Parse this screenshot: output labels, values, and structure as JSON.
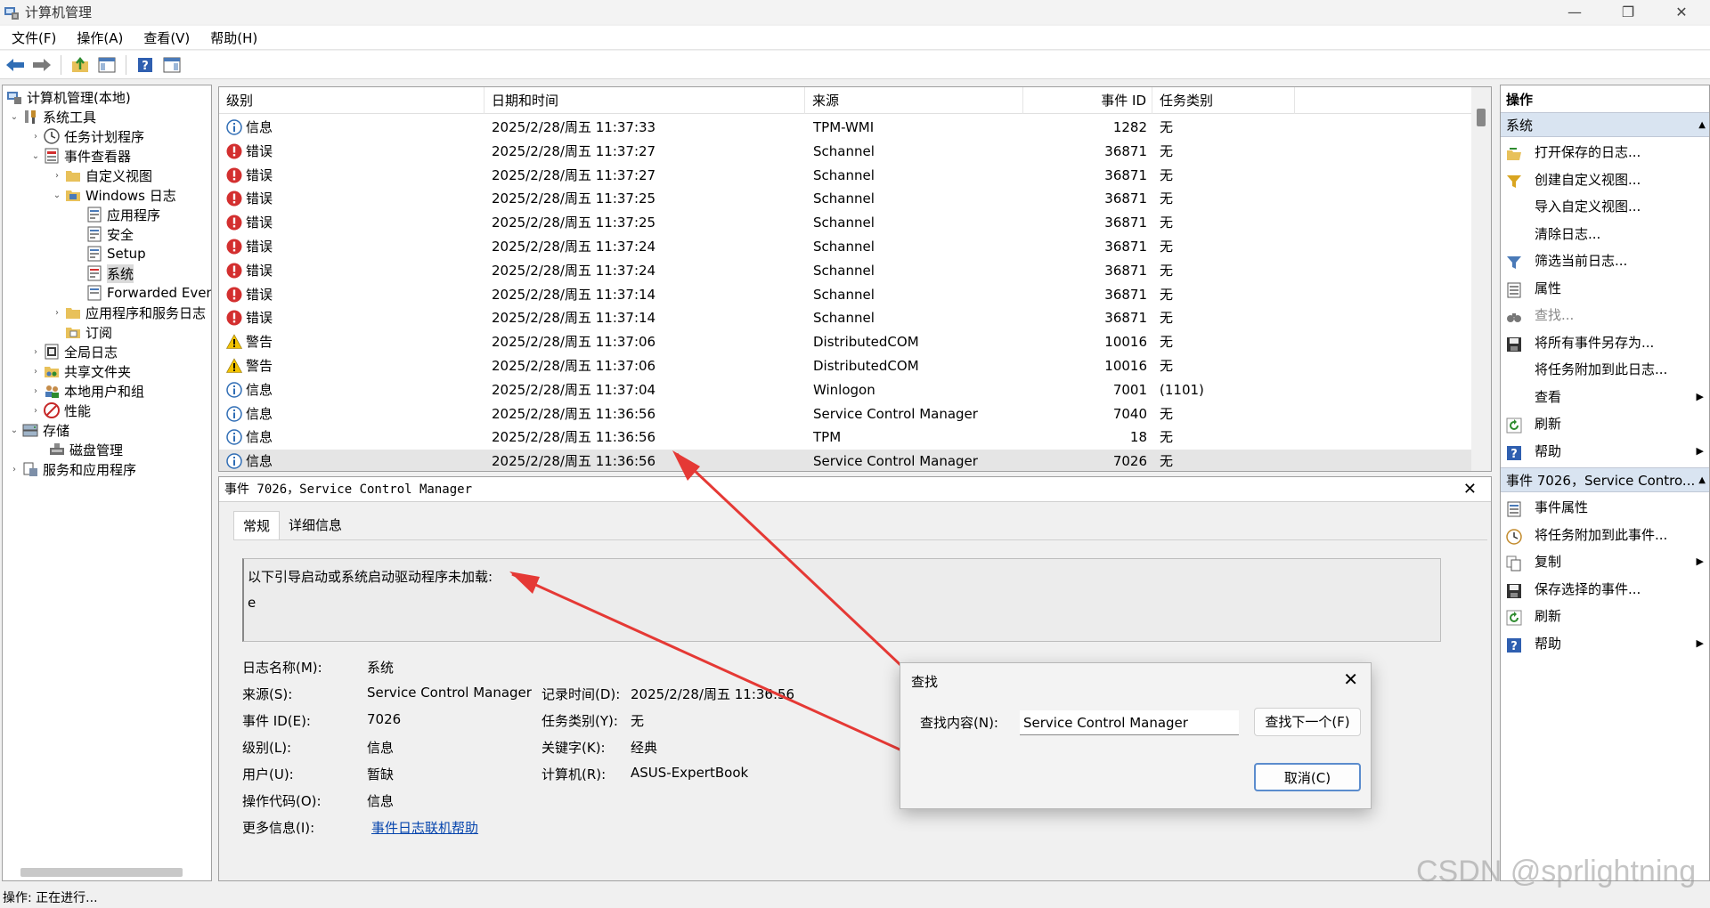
{
  "window": {
    "title": "计算机管理",
    "minimize": "—",
    "maximize": "❐",
    "close": "✕"
  },
  "menu": [
    "文件(F)",
    "操作(A)",
    "查看(V)",
    "帮助(H)"
  ],
  "tree": [
    {
      "label": "计算机管理(本地)",
      "icon": "computer-management-icon"
    },
    {
      "label": "系统工具",
      "icon": "tools-icon",
      "exp": "⌄"
    },
    {
      "label": "任务计划程序",
      "icon": "clock-icon",
      "exp": "›"
    },
    {
      "label": "事件查看器",
      "icon": "event-viewer-icon",
      "exp": "⌄"
    },
    {
      "label": "自定义视图",
      "icon": "folder-icon",
      "exp": "›"
    },
    {
      "label": "Windows 日志",
      "icon": "folder-icon",
      "exp": "⌄"
    },
    {
      "label": "应用程序",
      "icon": "log-icon"
    },
    {
      "label": "安全",
      "icon": "log-icon"
    },
    {
      "label": "Setup",
      "icon": "log-icon"
    },
    {
      "label": "系统",
      "icon": "log-icon"
    },
    {
      "label": "Forwarded Even",
      "icon": "log-icon"
    },
    {
      "label": "应用程序和服务日志",
      "icon": "folder-icon",
      "exp": "›"
    },
    {
      "label": "订阅",
      "icon": "subscription-icon"
    },
    {
      "label": "全局日志",
      "icon": "log-icon",
      "exp": "›"
    },
    {
      "label": "共享文件夹",
      "icon": "shared-folder-icon",
      "exp": "›"
    },
    {
      "label": "本地用户和组",
      "icon": "users-icon",
      "exp": "›"
    },
    {
      "label": "性能",
      "icon": "performance-icon",
      "exp": "›"
    },
    {
      "label": "存储",
      "icon": "storage-icon",
      "exp": "⌄"
    },
    {
      "label": "磁盘管理",
      "icon": "disk-icon"
    },
    {
      "label": "服务和应用程序",
      "icon": "services-icon",
      "exp": "›"
    }
  ],
  "list": {
    "headers": [
      "级别",
      "日期和时间",
      "来源",
      "事件 ID",
      "任务类别"
    ],
    "rows": [
      {
        "level": "信息",
        "type": "info",
        "datetime": "2025/2/28/周五 11:37:33",
        "source": "TPM-WMI",
        "id": "1282",
        "task": "无"
      },
      {
        "level": "错误",
        "type": "error",
        "datetime": "2025/2/28/周五 11:37:27",
        "source": "Schannel",
        "id": "36871",
        "task": "无"
      },
      {
        "level": "错误",
        "type": "error",
        "datetime": "2025/2/28/周五 11:37:27",
        "source": "Schannel",
        "id": "36871",
        "task": "无"
      },
      {
        "level": "错误",
        "type": "error",
        "datetime": "2025/2/28/周五 11:37:25",
        "source": "Schannel",
        "id": "36871",
        "task": "无"
      },
      {
        "level": "错误",
        "type": "error",
        "datetime": "2025/2/28/周五 11:37:25",
        "source": "Schannel",
        "id": "36871",
        "task": "无"
      },
      {
        "level": "错误",
        "type": "error",
        "datetime": "2025/2/28/周五 11:37:24",
        "source": "Schannel",
        "id": "36871",
        "task": "无"
      },
      {
        "level": "错误",
        "type": "error",
        "datetime": "2025/2/28/周五 11:37:24",
        "source": "Schannel",
        "id": "36871",
        "task": "无"
      },
      {
        "level": "错误",
        "type": "error",
        "datetime": "2025/2/28/周五 11:37:14",
        "source": "Schannel",
        "id": "36871",
        "task": "无"
      },
      {
        "level": "错误",
        "type": "error",
        "datetime": "2025/2/28/周五 11:37:14",
        "source": "Schannel",
        "id": "36871",
        "task": "无"
      },
      {
        "level": "警告",
        "type": "warning",
        "datetime": "2025/2/28/周五 11:37:06",
        "source": "DistributedCOM",
        "id": "10016",
        "task": "无"
      },
      {
        "level": "警告",
        "type": "warning",
        "datetime": "2025/2/28/周五 11:37:06",
        "source": "DistributedCOM",
        "id": "10016",
        "task": "无"
      },
      {
        "level": "信息",
        "type": "info",
        "datetime": "2025/2/28/周五 11:37:04",
        "source": "Winlogon",
        "id": "7001",
        "task": "(1101)"
      },
      {
        "level": "信息",
        "type": "info",
        "datetime": "2025/2/28/周五 11:36:56",
        "source": "Service Control Manager",
        "id": "7040",
        "task": "无"
      },
      {
        "level": "信息",
        "type": "info",
        "datetime": "2025/2/28/周五 11:36:56",
        "source": "TPM",
        "id": "18",
        "task": "无"
      },
      {
        "level": "信息",
        "type": "info",
        "datetime": "2025/2/28/周五 11:36:56",
        "source": "Service Control Manager",
        "id": "7026",
        "task": "无",
        "selected": true
      }
    ]
  },
  "detail": {
    "header": "事件 7026，Service Control Manager",
    "close": "✕",
    "tabs": [
      "常规",
      "详细信息"
    ],
    "description_line1": "以下引导启动或系统启动驱动程序未加载:",
    "description_line2": "e",
    "fields": {
      "log_name_label": "日志名称(M):",
      "log_name": "系统",
      "source_label": "来源(S):",
      "source": "Service Control Manager",
      "logged_label": "记录时间(D):",
      "logged": "2025/2/28/周五 11:36:56",
      "event_id_label": "事件 ID(E):",
      "event_id": "7026",
      "task_label": "任务类别(Y):",
      "task": "无",
      "level_label": "级别(L):",
      "level": "信息",
      "keywords_label": "关键字(K):",
      "keywords": "经典",
      "user_label": "用户(U):",
      "user": "暂缺",
      "computer_label": "计算机(R):",
      "computer": "ASUS-ExpertBook",
      "opcode_label": "操作代码(O):",
      "opcode": "信息",
      "more_label": "更多信息(I):",
      "more_link": "事件日志联机帮助"
    }
  },
  "actions": {
    "title": "操作",
    "section1": "系统",
    "items1": [
      {
        "label": "打开保存的日志...",
        "icon": "open-folder-icon"
      },
      {
        "label": "创建自定义视图...",
        "icon": "filter-create-icon"
      },
      {
        "label": "导入自定义视图...",
        "icon": ""
      },
      {
        "label": "清除日志...",
        "icon": ""
      },
      {
        "label": "筛选当前日志...",
        "icon": "filter-icon"
      },
      {
        "label": "属性",
        "icon": "properties-icon"
      },
      {
        "label": "查找...",
        "icon": "binoculars-icon",
        "disabled": true
      },
      {
        "label": "将所有事件另存为...",
        "icon": "save-icon"
      },
      {
        "label": "将任务附加到此日志...",
        "icon": ""
      },
      {
        "label": "查看",
        "icon": "",
        "submenu": true
      },
      {
        "label": "刷新",
        "icon": "refresh-icon"
      },
      {
        "label": "帮助",
        "icon": "help-icon",
        "submenu": true
      }
    ],
    "section2": "事件 7026，Service Contro...",
    "items2": [
      {
        "label": "事件属性",
        "icon": "event-properties-icon"
      },
      {
        "label": "将任务附加到此事件...",
        "icon": "task-clock-icon"
      },
      {
        "label": "复制",
        "icon": "copy-icon",
        "submenu": true
      },
      {
        "label": "保存选择的事件...",
        "icon": "save-icon"
      },
      {
        "label": "刷新",
        "icon": "refresh-icon"
      },
      {
        "label": "帮助",
        "icon": "help-icon",
        "submenu": true
      }
    ]
  },
  "find_dialog": {
    "title": "查找",
    "close": "✕",
    "field_label": "查找内容(N):",
    "field_value": "Service Control Manager",
    "find_next": "查找下一个(F)",
    "cancel": "取消(C)"
  },
  "status": "操作: 正在进行...",
  "watermark": "CSDN @sprlightning",
  "colors": {
    "error": "#d32f2f",
    "info": "#2f6db5",
    "warning": "#f2c200",
    "annotation_arrow": "#e53935",
    "link": "#0645ad"
  }
}
